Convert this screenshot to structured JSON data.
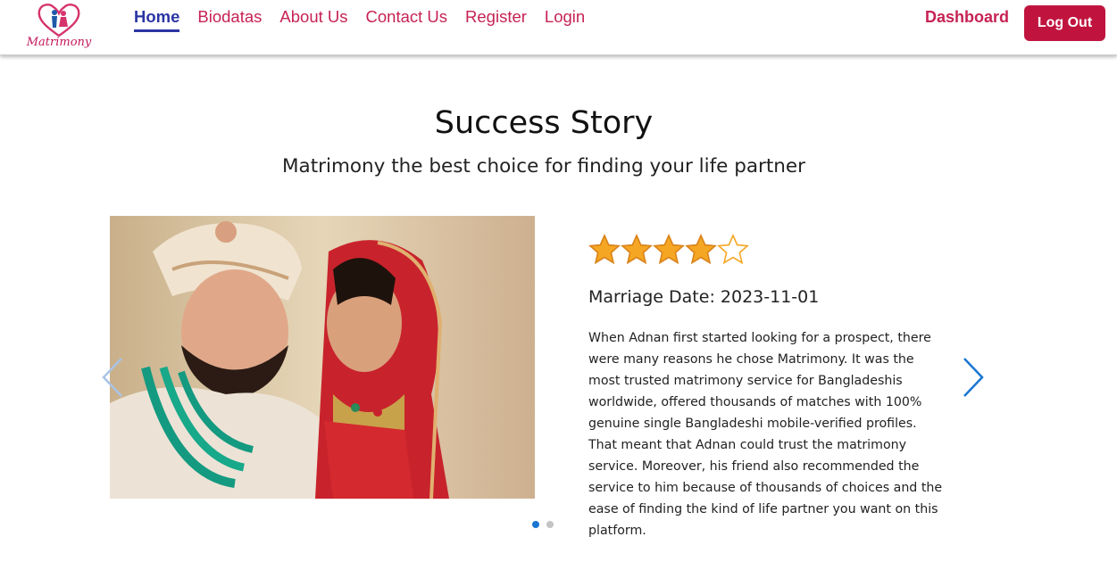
{
  "brand": {
    "logo_text": "Matrimony"
  },
  "nav": {
    "links": [
      {
        "label": "Home"
      },
      {
        "label": "Biodatas"
      },
      {
        "label": "About Us"
      },
      {
        "label": "Contact Us"
      },
      {
        "label": "Register"
      },
      {
        "label": "Login"
      }
    ],
    "active": "Home",
    "dashboard_label": "Dashboard",
    "logout_label": "Log Out"
  },
  "section": {
    "title": "Success Story",
    "subtitle": "Matrimony the best choice for finding your life partner"
  },
  "slide": {
    "rating": 4,
    "rating_max": 5,
    "marriage_date_text": "Marriage Date: 2023-11-01",
    "story": "When Adnan first started looking for a prospect, there were many reasons he chose Matrimony. It was the most trusted matrimony service for Bangladeshis worldwide, offered thousands of matches with 100% genuine single Bangladeshi mobile-verified profiles. That meant that Adnan could trust the matrimony service. Moreover, his friend also recommended the service to him because of thousands of choices and the ease of finding the kind of life partner you want on this platform."
  },
  "carousel": {
    "current_slide": 1,
    "total_slides": 2
  },
  "icons": {
    "prev": "chevron-left-icon",
    "next": "chevron-right-icon",
    "star_filled": "star-filled-icon",
    "star_empty": "star-outline-icon"
  },
  "colors": {
    "brand_pink": "#c62354",
    "active_nav": "#2b35a3",
    "logout_bg": "#c0143f",
    "star": "#f5a623",
    "arrow": "#1976d2"
  }
}
